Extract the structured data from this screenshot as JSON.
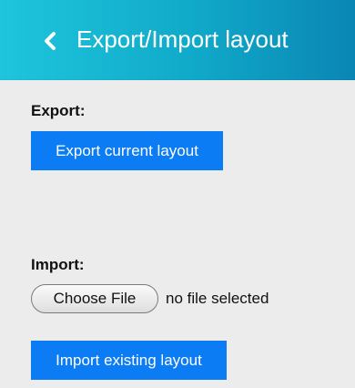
{
  "header": {
    "title": "Export/Import layout",
    "back_icon": "chevron-left-icon",
    "gradient_colors": [
      "#1ec5dc",
      "#0a86b4"
    ]
  },
  "export": {
    "label": "Export:",
    "button_label": "Export current layout"
  },
  "import": {
    "label": "Import:",
    "choose_file_label": "Choose File",
    "file_status": "no file selected",
    "button_label": "Import existing layout"
  },
  "theme": {
    "page_background": "#ececec",
    "button_color": "#0c7cf5"
  }
}
